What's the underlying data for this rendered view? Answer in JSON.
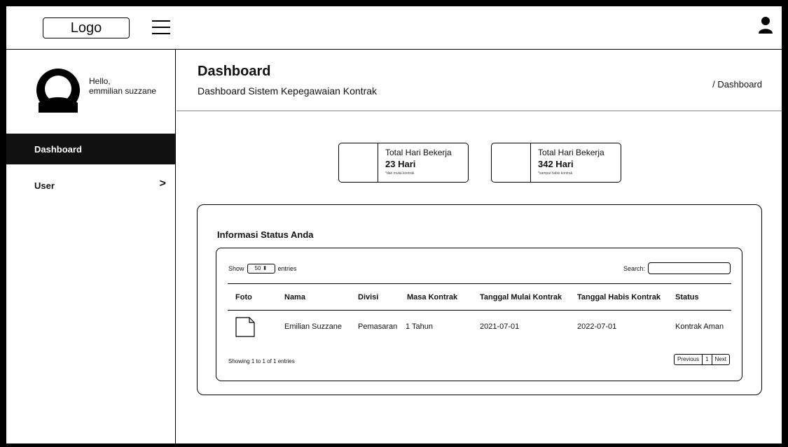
{
  "topbar": {
    "logo": "Logo"
  },
  "sidebar": {
    "hello": "Hello,",
    "username": "emmilian suzzane",
    "items": [
      {
        "label": "Dashboard",
        "active": true
      },
      {
        "label": "User",
        "active": false
      }
    ]
  },
  "header": {
    "title": "Dashboard",
    "subtitle": "Dashboard Sistem Kepegawaian Kontrak",
    "breadcrumb": "/ Dashboard"
  },
  "stats": [
    {
      "label": "Total Hari Bekerja",
      "value": "23 Hari",
      "note": "*dari mulai kontrak"
    },
    {
      "label": "Total Hari Bekerja",
      "value": "342 Hari",
      "note": "*sampai habis kontrak"
    }
  ],
  "panel": {
    "title": "Informasi Status Anda",
    "show_label": "Show",
    "entries_select": "50 ⬍",
    "entries_label": "entries",
    "search_label": "Search:",
    "columns": [
      "Foto",
      "Nama",
      "Divisi",
      "Masa Kontrak",
      "Tanggal Mulai Kontrak",
      "Tanggal Habis Kontrak",
      "Status"
    ],
    "rows": [
      {
        "nama": "Emilian Suzzane",
        "divisi": "Pemasaran",
        "masa": "1 Tahun",
        "mulai": "2021-07-01",
        "habis": "2022-07-01",
        "status": "Kontrak Aman"
      }
    ],
    "info": "Showing 1 to 1 of 1 entries",
    "pagination": {
      "previous": "Previous",
      "page": "1",
      "next": "Next"
    }
  },
  "icons": [
    "menu-icon",
    "user-icon",
    "avatar-icon",
    "chevron-right-icon",
    "file-icon"
  ]
}
